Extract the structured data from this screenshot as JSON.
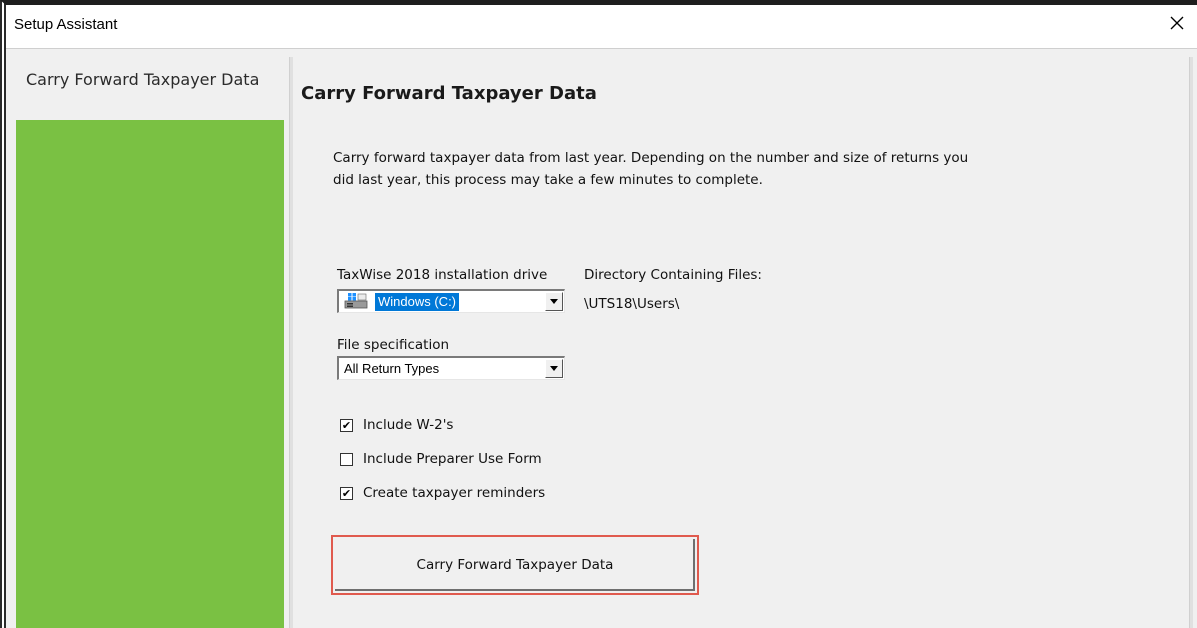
{
  "window": {
    "title": "Setup Assistant",
    "close_symbol": "✕"
  },
  "sidebar": {
    "items": [
      {
        "label": "Carry Forward Taxpayer Data",
        "active": true
      }
    ],
    "color": "#7ac143"
  },
  "main": {
    "title": "Carry Forward Taxpayer Data",
    "description": "Carry forward taxpayer data from last year.  Depending on the number and size of returns you did last year, this process may take a few minutes to complete.",
    "drive": {
      "label": "TaxWise 2018 installation drive",
      "value": "Windows (C:)",
      "icon": "windows-drive-icon"
    },
    "directory": {
      "label": "Directory Containing Files:",
      "value": "\\UTS18\\Users\\"
    },
    "file_spec": {
      "label": "File specification",
      "value": "All Return Types"
    },
    "checkboxes": [
      {
        "label": "Include W-2's",
        "checked": true
      },
      {
        "label": "Include Preparer Use Form",
        "checked": false
      },
      {
        "label": "Create taxpayer reminders",
        "checked": true
      }
    ],
    "action_button": {
      "label": "Carry Forward Taxpayer Data",
      "highlight_color": "#e05a4e"
    }
  },
  "colors": {
    "accent_green": "#7ac143",
    "selection_blue": "#0078d7",
    "highlight_red": "#e05a4e"
  }
}
